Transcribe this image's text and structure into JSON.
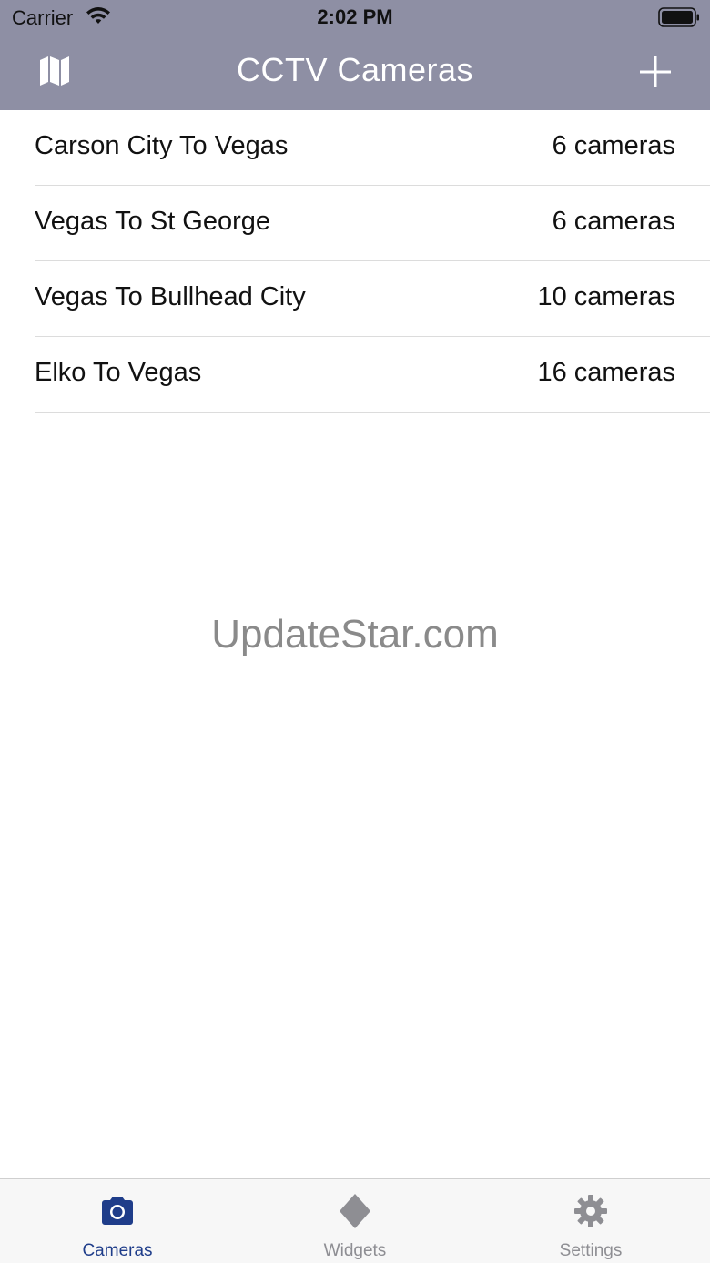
{
  "status_bar": {
    "carrier": "Carrier",
    "time": "2:02 PM",
    "wifi_icon": "wifi-icon",
    "battery_icon": "battery-icon"
  },
  "nav": {
    "title": "CCTV Cameras",
    "left_icon": "map-icon",
    "right_icon": "plus-icon"
  },
  "routes": [
    {
      "name": "Carson City To Vegas",
      "count": "6 cameras"
    },
    {
      "name": "Vegas To St George",
      "count": "6 cameras"
    },
    {
      "name": "Vegas To Bullhead City",
      "count": "10 cameras"
    },
    {
      "name": "Elko To Vegas",
      "count": "16 cameras"
    }
  ],
  "watermark": "UpdateStar.com",
  "tabs": [
    {
      "label": "Cameras",
      "icon": "camera-icon",
      "selected": true
    },
    {
      "label": "Widgets",
      "icon": "diamond-icon",
      "selected": false
    },
    {
      "label": "Settings",
      "icon": "gear-icon",
      "selected": false
    }
  ],
  "colors": {
    "nav_background": "#8e8fa4",
    "tab_active": "#1f3d8a",
    "tab_inactive": "#8e8e93"
  }
}
